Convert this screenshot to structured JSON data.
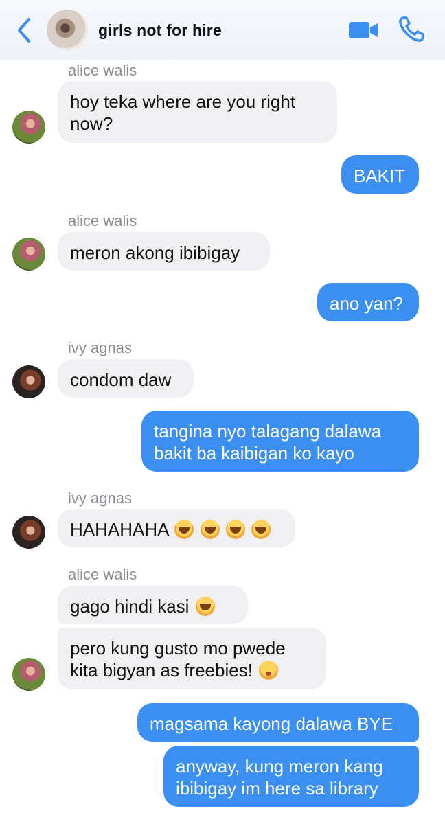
{
  "header": {
    "title": "girls not for hire",
    "back_icon": "chevron-left-icon",
    "video_icon": "video-call-icon",
    "phone_icon": "phone-call-icon",
    "accent_color": "#3a8ff0"
  },
  "messages": [
    {
      "sender": "alice walis",
      "text": "hoy teka where are you right"
    },
    {
      "text_line2": "now?"
    },
    {
      "outgoing": true,
      "text": "BAKIT"
    },
    {
      "sender": "alice walis",
      "text": "meron akong ibibigay"
    },
    {
      "outgoing": true,
      "text": "ano yan?"
    },
    {
      "sender": "ivy agnas",
      "text": "condom daw"
    },
    {
      "outgoing": true,
      "text": "tangina nyo talagang dalawa",
      "text_line2": "bakit ba kaibigan ko kayo"
    },
    {
      "sender": "ivy agnas",
      "text": "HAHAHAHA"
    },
    {
      "sender": "alice walis",
      "text": "gago hindi kasi"
    },
    {
      "text": "pero kung gusto mo pwede",
      "text_line2": "kita bigyan as freebies!"
    },
    {
      "outgoing": true,
      "text": "magsama kayong dalawa BYE"
    },
    {
      "outgoing": true,
      "text": "anyway, kung meron kang",
      "text_line2": "ibibigay im here sa library"
    }
  ]
}
